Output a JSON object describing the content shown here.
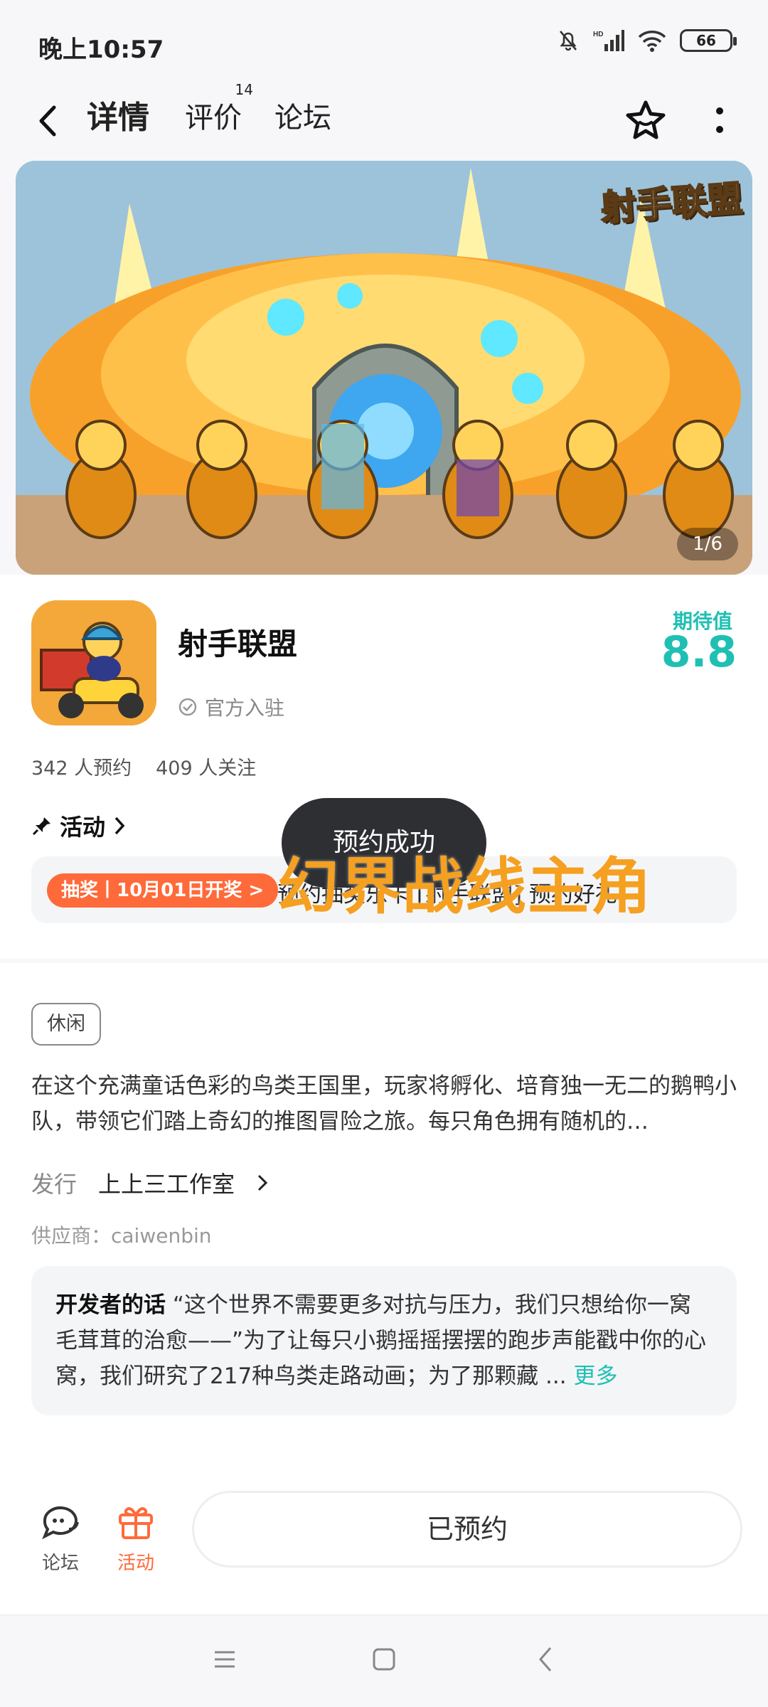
{
  "status_bar": {
    "time": "晚上10:57",
    "battery": "66",
    "network": "HD"
  },
  "nav": {
    "tabs": [
      {
        "label": "详情",
        "active": true
      },
      {
        "label": "评价",
        "badge": "14"
      },
      {
        "label": "论坛"
      }
    ]
  },
  "banner": {
    "logo_text": "射手联盟",
    "pager": "1/6"
  },
  "app": {
    "name": "射手联盟",
    "official_label": "官方入驻",
    "expect_label": "期待值",
    "expect_value": "8.8",
    "reservations": "342 人预约",
    "followers": "409 人关注"
  },
  "activity": {
    "heading": "活动",
    "tag": "抽奖丨10月01日开奖 >",
    "text": "预约抽奖乐卡 [射手联盟] 预约好礼"
  },
  "toast": {
    "text": "预约成功"
  },
  "overlay_title": "幻界战线主角",
  "details": {
    "genre": "休闲",
    "description": "在这个充满童话色彩的鸟类王国里，玩家将孵化、培育独一无二的鹅鸭小队，带领它们踏上奇幻的推图冒险之旅。每只角色拥有随机的…",
    "publisher_label": "发行",
    "publisher_value": "上上三工作室",
    "supplier": "供应商：caiwenbin",
    "developer_label": "开发者的话",
    "developer_text": "“这个世界不需要更多对抗与压力，我们只想给你一窝毛茸茸的治愈——”为了让每只小鹅摇摇摆摆的跑步声能戳中你的心窝，我们研究了217种鸟类走路动画；为了那颗藏 ...",
    "more_label": "更多"
  },
  "bottom_bar": {
    "forum_label": "论坛",
    "activity_label": "活动",
    "reserve_button": "已预约"
  },
  "colors": {
    "accent": "#1fc0b3",
    "orange": "#ff6a3a",
    "toast_bg": "#2e2f33"
  }
}
